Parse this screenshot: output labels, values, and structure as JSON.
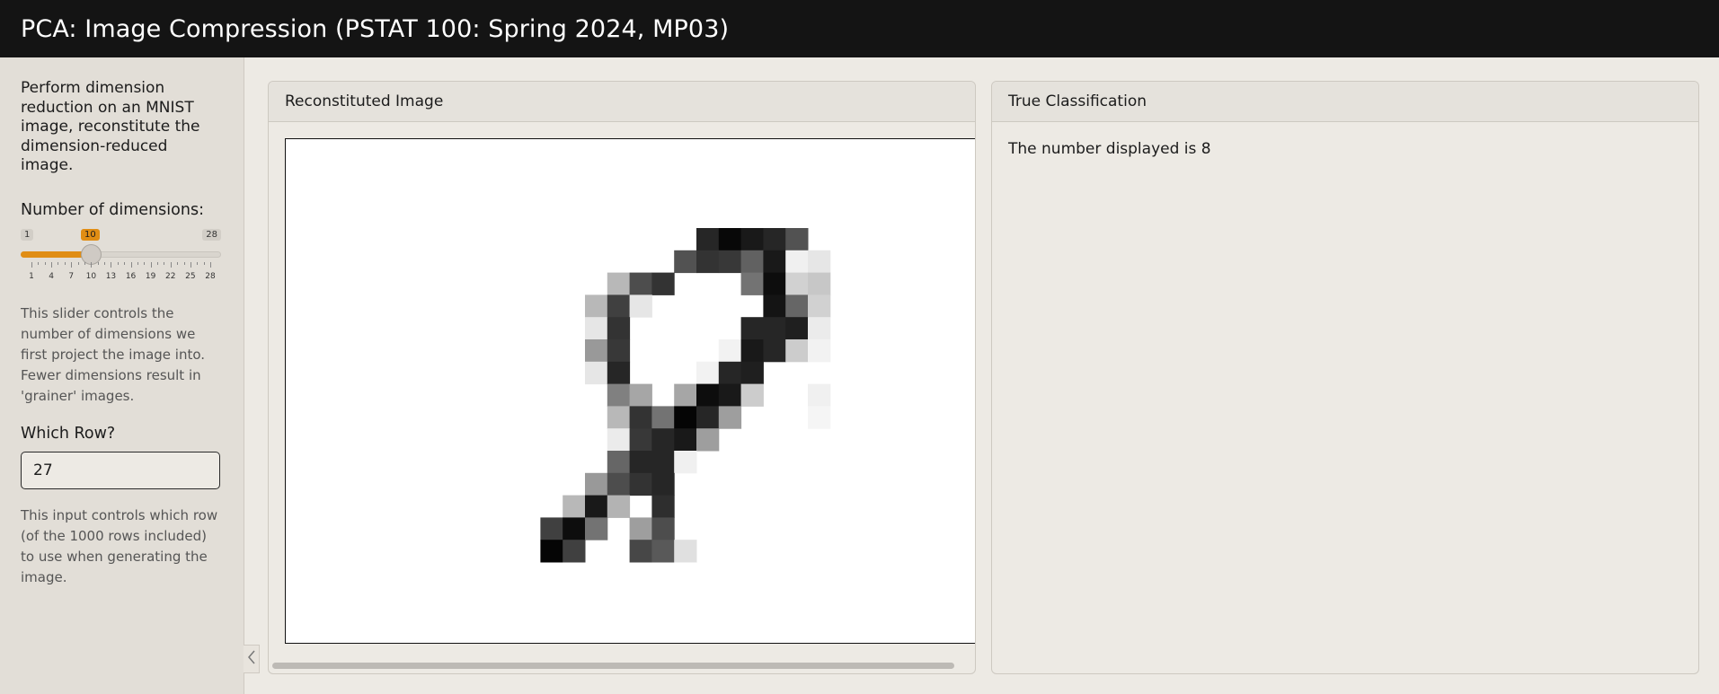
{
  "app": {
    "title": "PCA: Image Compression (PSTAT 100: Spring 2024, MP03)"
  },
  "sidebar": {
    "description": "Perform dimension reduction on an MNIST image, reconstitute the dimension-reduced image.",
    "dims_label": "Number of dimensions:",
    "slider": {
      "min": 1,
      "max": 28,
      "value": 10,
      "min_label": "1",
      "max_label": "28",
      "value_label": "10",
      "tick_labels": [
        "1",
        "4",
        "7",
        "10",
        "13",
        "16",
        "19",
        "22",
        "25",
        "28"
      ],
      "fill_color": "#e08d14"
    },
    "slider_help": "This slider controls the number of dimensions we first project the image into. Fewer dimensions result in 'grainer' images.",
    "row_label": "Which Row?",
    "row_value": "27",
    "row_help": "This input controls which row (of the 1000 rows included) to use when generating the image.",
    "collapse_icon": "chevron-left-icon"
  },
  "image_card": {
    "title": "Reconstituted Image",
    "digit_grid": {
      "cols": 16,
      "rows": 15,
      "intensity": [
        [
          0,
          0,
          0,
          0,
          0,
          0,
          0,
          0,
          0,
          0,
          0.85,
          0.97,
          0.9,
          0.85,
          0.68,
          0
        ],
        [
          0,
          0,
          0,
          0,
          0,
          0,
          0,
          0,
          0,
          0.68,
          0.8,
          0.78,
          0.62,
          0.9,
          0.06,
          0.1
        ],
        [
          0,
          0,
          0,
          0,
          0,
          0,
          0.28,
          0.7,
          0.8,
          0,
          0,
          0,
          0.55,
          0.95,
          0.18,
          0.22
        ],
        [
          0,
          0,
          0,
          0,
          0,
          0.28,
          0.75,
          0.1,
          0,
          0,
          0,
          0,
          0,
          0.92,
          0.6,
          0.18
        ],
        [
          0,
          0,
          0,
          0,
          0,
          0.1,
          0.8,
          0,
          0,
          0,
          0,
          0,
          0.85,
          0.85,
          0.88,
          0.08
        ],
        [
          0,
          0,
          0,
          0,
          0,
          0.4,
          0.78,
          0,
          0,
          0,
          0,
          0.05,
          0.9,
          0.85,
          0.2,
          0.05
        ],
        [
          0,
          0,
          0,
          0,
          0,
          0.1,
          0.85,
          0,
          0,
          0,
          0.05,
          0.85,
          0.88,
          0,
          0,
          0
        ],
        [
          0,
          0,
          0,
          0,
          0,
          0,
          0.5,
          0.35,
          0,
          0.35,
          0.95,
          0.9,
          0.2,
          0,
          0,
          0.06
        ],
        [
          0,
          0,
          0,
          0,
          0,
          0,
          0.28,
          0.8,
          0.55,
          0.98,
          0.85,
          0.38,
          0,
          0,
          0,
          0.04
        ],
        [
          0,
          0,
          0,
          0,
          0,
          0,
          0.08,
          0.78,
          0.85,
          0.9,
          0.38,
          0,
          0,
          0,
          0,
          0
        ],
        [
          0,
          0,
          0,
          0,
          0,
          0,
          0.6,
          0.85,
          0.85,
          0.06,
          0,
          0,
          0,
          0,
          0,
          0
        ],
        [
          0,
          0,
          0,
          0,
          0,
          0.4,
          0.7,
          0.8,
          0.85,
          0,
          0,
          0,
          0,
          0,
          0,
          0
        ],
        [
          0,
          0,
          0,
          0,
          0.28,
          0.9,
          0.3,
          0,
          0.82,
          0,
          0,
          0,
          0,
          0,
          0,
          0
        ],
        [
          0,
          0,
          0,
          0.75,
          0.95,
          0.55,
          0,
          0.38,
          0.7,
          0,
          0,
          0,
          0,
          0,
          0,
          0
        ],
        [
          0,
          0,
          0,
          0.98,
          0.75,
          0,
          0,
          0.72,
          0.65,
          0.12,
          0,
          0,
          0,
          0,
          0,
          0
        ]
      ]
    }
  },
  "class_card": {
    "title": "True Classification",
    "text": "The number displayed is 8"
  }
}
